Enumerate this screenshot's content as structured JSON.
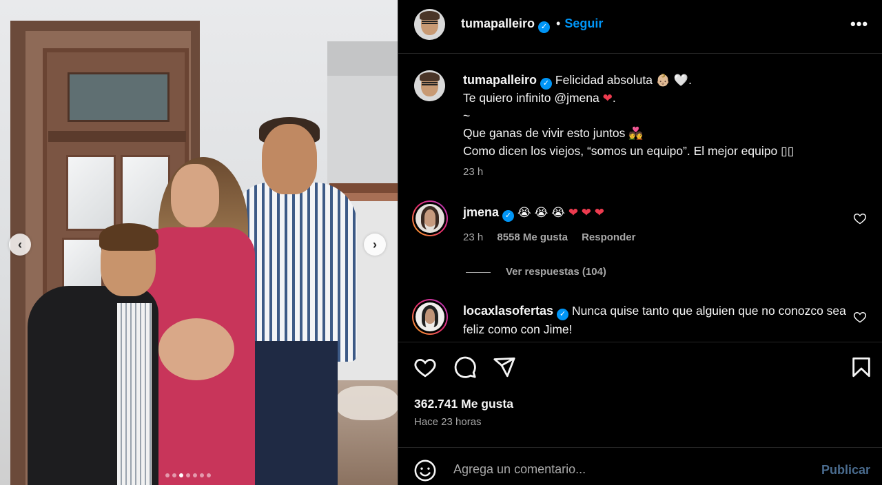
{
  "post": {
    "author": "tumapalleiro",
    "follow_label": "Seguir",
    "bullet": "•",
    "more_label": "•••",
    "carousel": {
      "total": 7,
      "active_index": 3
    }
  },
  "caption": {
    "author": "tumapalleiro",
    "line1": "Felicidad absoluta",
    "line1_end": ".",
    "line2": "Te quiero infinito",
    "mention": "@jmena",
    "line2_end": ".",
    "line3": "~",
    "line4": "Que ganas de vivir esto juntos",
    "line5": "Como dicen los viejos, “somos un equipo”. El mejor equipo",
    "time": "23 h"
  },
  "comments": [
    {
      "author": "jmena",
      "emojis": "😭 😭 😭",
      "time": "23 h",
      "likes": "8558 Me gusta",
      "reply_label": "Responder",
      "view_replies": "Ver respuestas (104)"
    },
    {
      "author": "locaxlasofertas",
      "text": "Nunca quise tanto que alguien que no conozco sea feliz como con Jime!"
    }
  ],
  "stats": {
    "likes": "362.741 Me gusta",
    "posted": "Hace 23 horas"
  },
  "composer": {
    "placeholder": "Agrega un comentario...",
    "publish_label": "Publicar"
  },
  "colors": {
    "accent": "#0095f6",
    "heart": "#ed3b4f",
    "publish_disabled": "#4a6c8f"
  }
}
